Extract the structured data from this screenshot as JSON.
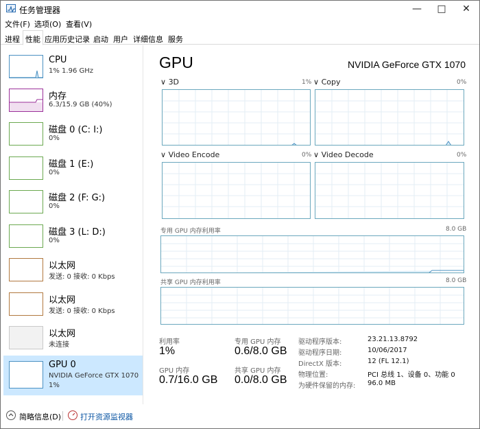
{
  "window": {
    "title": "任务管理器"
  },
  "menu": [
    "文件(F)",
    "选项(O)",
    "查看(V)"
  ],
  "tabs": [
    "进程",
    "性能",
    "应用历史记录",
    "启动",
    "用户",
    "详细信息",
    "服务"
  ],
  "active_tab": "性能",
  "sidebar": [
    {
      "title": "CPU",
      "sub": "1% 1.96 GHz",
      "color": "#4a90c2"
    },
    {
      "title": "内存",
      "sub": "6.3/15.9 GB (40%)",
      "color": "#9b2f99"
    },
    {
      "title": "磁盘 0 (C: I:)",
      "sub": "0%",
      "color": "#6aa84f"
    },
    {
      "title": "磁盘 1 (E:)",
      "sub": "0%",
      "color": "#6aa84f"
    },
    {
      "title": "磁盘 2 (F: G:)",
      "sub": "0%",
      "color": "#6aa84f"
    },
    {
      "title": "磁盘 3 (L: D:)",
      "sub": "0%",
      "color": "#6aa84f"
    },
    {
      "title": "以太网",
      "sub": "发送: 0 接收: 0 Kbps",
      "color": "#b1783e"
    },
    {
      "title": "以太网",
      "sub": "发送: 0 接收: 0 Kbps",
      "color": "#b1783e"
    },
    {
      "title": "以太网",
      "sub": "未连接",
      "color": "#c9c9c9"
    },
    {
      "title": "GPU 0",
      "sub": "NVIDIA GeForce GTX 1070",
      "sub2": "1%",
      "color": "#4a90c2"
    }
  ],
  "main": {
    "title": "GPU",
    "model": "NVIDIA GeForce GTX 1070",
    "engines": [
      {
        "name": "3D",
        "pct": "1%"
      },
      {
        "name": "Copy",
        "pct": "0%"
      },
      {
        "name": "Video Encode",
        "pct": "0%"
      },
      {
        "name": "Video Decode",
        "pct": "0%"
      }
    ],
    "dedicated_label": "专用 GPU 内存利用率",
    "dedicated_max": "8.0 GB",
    "shared_label": "共享 GPU 内存利用率",
    "shared_max": "8.0 GB",
    "stats": {
      "utilization_label": "利用率",
      "utilization_value": "1%",
      "dedicated_mem_label": "专用 GPU 内存",
      "dedicated_mem_value": "0.6/8.0 GB",
      "gpu_mem_label": "GPU 内存",
      "gpu_mem_value": "0.7/16.0 GB",
      "shared_mem_label": "共享 GPU 内存",
      "shared_mem_value": "0.0/8.0 GB"
    },
    "details": [
      {
        "label": "驱动程序版本:",
        "value": "23.21.13.8792"
      },
      {
        "label": "驱动程序日期:",
        "value": "10/06/2017"
      },
      {
        "label": "DirectX 版本:",
        "value": "12 (FL 12.1)"
      },
      {
        "label": "物理位置:",
        "value": "PCI 总线 1、设备 0、功能 0"
      },
      {
        "label": "为硬件保留的内存:",
        "value": "96.0 MB"
      }
    ]
  },
  "footer": {
    "summary_label": "简略信息(D)",
    "monitor_link": "打开资源监视器"
  }
}
